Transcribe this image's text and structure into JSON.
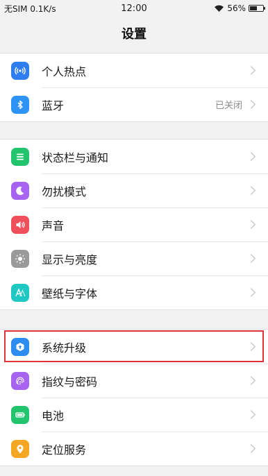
{
  "status": {
    "left": "无SIM 0.1K/s",
    "time": "12:00",
    "battery": "56%",
    "battery_level": 0.56
  },
  "title": "设置",
  "groups": [
    {
      "items": [
        {
          "label": "个人热点",
          "value": "",
          "icon": "hotspot-icon",
          "color": "#2f7ef0"
        },
        {
          "label": "蓝牙",
          "value": "已关闭",
          "icon": "bluetooth-icon",
          "color": "#2d93f5"
        }
      ]
    },
    {
      "items": [
        {
          "label": "状态栏与通知",
          "value": "",
          "icon": "notification-icon",
          "color": "#22c46e"
        },
        {
          "label": "勿扰模式",
          "value": "",
          "icon": "moon-icon",
          "color": "#a764f0"
        },
        {
          "label": "声音",
          "value": "",
          "icon": "speaker-icon",
          "color": "#f0505a"
        },
        {
          "label": "显示与亮度",
          "value": "",
          "icon": "brightness-icon",
          "color": "#9a9a9a"
        },
        {
          "label": "壁纸与字体",
          "value": "",
          "icon": "font-icon",
          "color": "#1fc8c2"
        }
      ]
    },
    {
      "items": [
        {
          "label": "系统升级",
          "value": "",
          "icon": "system-upgrade-icon",
          "color": "#2d8cf0"
        },
        {
          "label": "指纹与密码",
          "value": "",
          "icon": "fingerprint-icon",
          "color": "#a764f0"
        },
        {
          "label": "电池",
          "value": "",
          "icon": "battery-icon",
          "color": "#22c46e"
        },
        {
          "label": "定位服务",
          "value": "",
          "icon": "location-icon",
          "color": "#f5a623"
        }
      ]
    }
  ]
}
